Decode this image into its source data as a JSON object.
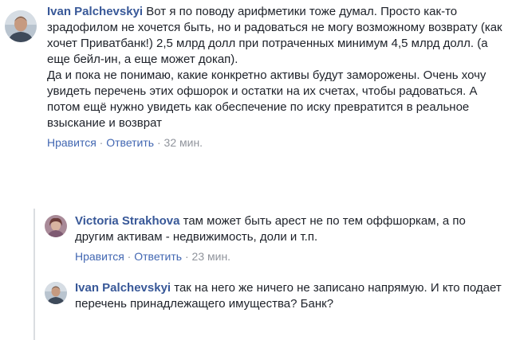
{
  "comments": [
    {
      "author": "Ivan Palchevskyi",
      "paragraphs": [
        "Вот я по поводу арифметики тоже думал. Просто как-то зрадофилом не хочется быть, но и радоваться не могу возможному возврату (как хочет Приватбанк!) 2,5 млрд долл при потраченных минимум 4,5 млрд долл. (а еще бейл-ин, а еще может докап).",
        "Да и пока не понимаю, какие конкретно активы будут заморожены. Очень хочу увидеть перечень этих офшорок и остатки на их счетах, чтобы радоваться. А потом ещё нужно увидеть как обеспечение по иску превратится в реальное взыскание и возврат"
      ],
      "like": "Нравится",
      "reply": "Ответить",
      "time": "32 мин."
    },
    {
      "author": "Victoria Strakhova",
      "text": "там может быть арест не по тем оффшоркам, а по другим активам - недвижимость, доли и т.п.",
      "like": "Нравится",
      "reply": "Ответить",
      "time": "23 мин."
    },
    {
      "author": "Ivan Palchevskyi",
      "text": "так на него же ничего не записано напрямую. И кто подает перечень принадлежащего имущества? Банк?"
    }
  ],
  "separator": "·",
  "colors": {
    "author": "#385898",
    "link": "#4267b2",
    "meta": "#90949c",
    "text": "#1d2129"
  }
}
